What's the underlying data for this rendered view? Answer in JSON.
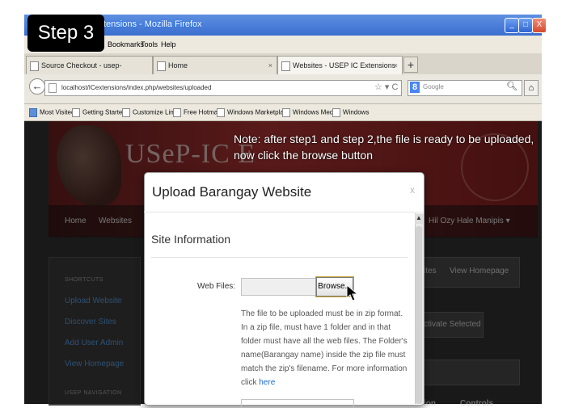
{
  "window": {
    "title": "tensions - Mozilla Firefox",
    "min_label": "_",
    "max_label": "□",
    "close_label": "X"
  },
  "menu": [
    "Bookmarks",
    "Tools",
    "Help"
  ],
  "tabs": [
    {
      "label": "Source Checkout - usep-accreditation-sy...",
      "close": "×"
    },
    {
      "label": "Home",
      "close": "×"
    },
    {
      "label": "Websites - USEP IC Extensions",
      "close": "×"
    }
  ],
  "new_tab_label": "+",
  "toolbar": {
    "url": "localhost/ICextensions/index.php/websites/uploaded",
    "url_actions": "☆ ▾ C",
    "search_engine_logo": "8",
    "search_placeholder": "Google",
    "search_icon": "magnifier-icon",
    "home_icon": "home-icon"
  },
  "bookmarks": [
    "Most Visited",
    "Getting Started",
    "Customize Links",
    "Free Hotmail",
    "Windows Marketplace",
    "Windows Media",
    "Windows"
  ],
  "banner": {
    "text": "USeP-IC E"
  },
  "site_nav": {
    "items": [
      "Home",
      "Websites",
      "Hil Ozy Hale Manipis ▾"
    ]
  },
  "sidebar": {
    "header_shortcuts": "SHORTCUTS",
    "links": [
      "Upload Website",
      "Discover Sites",
      "Add User Admin",
      "View Homepage"
    ],
    "header_nav": "USEP NAVIGATION"
  },
  "right_panel": {
    "partial_tab": "ites",
    "view_homepage": "View Homepage",
    "activate_selected": "ctivate Selected",
    "col_ion": "ion",
    "col_controls": "Controls"
  },
  "modal": {
    "title": "Upload Barangay Website",
    "close": "x",
    "scroll_up": "▲",
    "section_title": "Site Information",
    "web_files_label": "Web Files:",
    "browse_label": "Browse...",
    "help_text": "The file to be uploaded must be in zip format. In a zip file, must have 1 folder and in that folder must have all the web files. The Folder's name(Barangay name) inside the zip file must match the zip's filename. For more information click ",
    "help_link": "here"
  },
  "overlay": {
    "step_label": "Step 3",
    "note": "Note: after step1 and step 2,the file is ready to be uploaded, now click the browse button"
  },
  "colors": {
    "titlebar": "#3b6fd0",
    "banner": "#b33434",
    "link": "#1a6bc6"
  }
}
